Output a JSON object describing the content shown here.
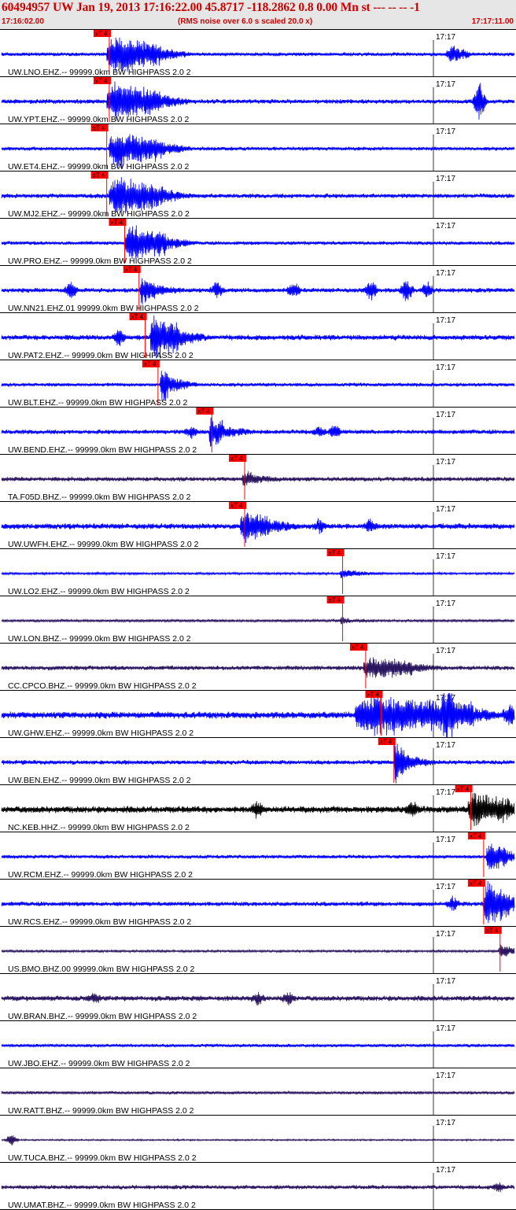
{
  "header": {
    "title": "60494957 UW Jan 19, 2013 17:16:22.00   45.8717 -118.2862  0.8 0.00 Mn st --- -- --  -1",
    "start_time": "17:16:02.00",
    "noise_note": "(RMS noise over 6.0 s scaled 20.0 x)",
    "end_time": "17:17:11.00"
  },
  "colors": {
    "header_bg": "#e6e6e6",
    "header_text": "#cc0000",
    "pick": "#ff0000",
    "trace_blue": "#0000ff",
    "trace_purple": "#2a1660",
    "trace_black": "#000000",
    "label_text": "#000000"
  },
  "minute_label": "17:17",
  "traces": [
    {
      "station": "UW.LNO.EHZ.-- 99999.0km BW  HIGHPASS  2.0  2",
      "pick": "xT 4",
      "pick_t": 0.21,
      "color": "blue",
      "mode": "burst",
      "burst": [
        0.205,
        0.31
      ],
      "base": 0.1,
      "peak": 1.0,
      "extra": [
        {
          "t": 0.88,
          "a": 0.5
        },
        {
          "t": 0.9,
          "a": 0.25
        }
      ]
    },
    {
      "station": "UW.YPT.EHZ.-- 99999.0km BW  HIGHPASS  2.0  2",
      "pick": "xT 4",
      "pick_t": 0.21,
      "color": "blue",
      "mode": "burst",
      "burst": [
        0.205,
        0.31
      ],
      "base": 0.12,
      "peak": 1.0,
      "extra": [
        {
          "t": 0.932,
          "a": 1.1
        }
      ]
    },
    {
      "station": "UW.ET4.EHZ.-- 99999.0km BW  HIGHPASS  2.0  2",
      "pick": "xT 4",
      "pick_t": 0.205,
      "color": "blue",
      "mode": "burst",
      "burst": [
        0.21,
        0.315
      ],
      "base": 0.1,
      "peak": 0.95,
      "extra": []
    },
    {
      "station": "UW.MJ2.EHZ.-- 99999.0km BW  HIGHPASS  2.0  2",
      "pick": "xT 4",
      "pick_t": 0.205,
      "color": "blue",
      "mode": "burst",
      "burst": [
        0.21,
        0.315
      ],
      "base": 0.12,
      "peak": 0.95,
      "extra": []
    },
    {
      "station": "UW.PRO.EHZ.-- 99999.0km BW  HIGHPASS  2.0  2",
      "pick": "xT 4",
      "pick_t": 0.24,
      "color": "blue",
      "mode": "burst",
      "burst": [
        0.24,
        0.32
      ],
      "base": 0.1,
      "peak": 1.0,
      "extra": []
    },
    {
      "station": "UW.NN21.EHZ.01 99999.0km BW  HIGHPASS  2.0  2",
      "pick": "xT 4",
      "pick_t": 0.268,
      "color": "blue",
      "mode": "burst",
      "burst": [
        0.27,
        0.3
      ],
      "base": 0.12,
      "peak": 0.7,
      "extra": [
        {
          "t": 0.135,
          "a": 0.45
        },
        {
          "t": 0.42,
          "a": 0.4
        },
        {
          "t": 0.57,
          "a": 0.4
        },
        {
          "t": 0.72,
          "a": 0.55
        },
        {
          "t": 0.79,
          "a": 0.6
        },
        {
          "t": 0.83,
          "a": 0.4
        }
      ]
    },
    {
      "station": "UW.PAT2.EHZ.-- 99999.0km BW  HIGHPASS  2.0  2",
      "pick": "xT 4",
      "pick_t": 0.28,
      "color": "blue",
      "mode": "clip",
      "burst": [
        0.29,
        0.345
      ],
      "base": 0.14,
      "peak": 1.2,
      "extra": [
        {
          "t": 0.23,
          "a": 0.45
        }
      ]
    },
    {
      "station": "UW.BLT.EHZ.-- 99999.0km BW  HIGHPASS  2.0  2",
      "pick": "xT 4",
      "pick_t": 0.305,
      "color": "blue",
      "mode": "clip",
      "burst": [
        0.31,
        0.325
      ],
      "base": 0.1,
      "peak": 1.2,
      "extra": []
    },
    {
      "station": "UW.BEND.EHZ.-- 99999.0km BW  HIGHPASS  2.0  2",
      "pick": "xT 4",
      "pick_t": 0.41,
      "color": "blue",
      "mode": "burst",
      "burst": [
        0.405,
        0.43
      ],
      "base": 0.12,
      "peak": 0.9,
      "extra": [
        {
          "t": 0.37,
          "a": 0.3
        },
        {
          "t": 0.62,
          "a": 0.3
        },
        {
          "t": 0.65,
          "a": 0.35
        }
      ]
    },
    {
      "station": "TA.F05D.BHZ.-- 99999.0km BW  HIGHPASS  2.0  2",
      "pick": "xT 4",
      "pick_t": 0.474,
      "color": "purple",
      "mode": "burst",
      "burst": [
        0.47,
        0.49
      ],
      "base": 0.12,
      "peak": 0.45,
      "extra": []
    },
    {
      "station": "UW.UWFH.EHZ.-- 99999.0km BW  HIGHPASS  2.0  2",
      "pick": "xT 4",
      "pick_t": 0.474,
      "color": "blue",
      "mode": "burst",
      "burst": [
        0.465,
        0.52
      ],
      "base": 0.15,
      "peak": 0.8,
      "extra": [
        {
          "t": 0.62,
          "a": 0.35
        },
        {
          "t": 0.72,
          "a": 0.3
        }
      ]
    },
    {
      "station": "UW.LO2.EHZ.-- 99999.0km BW  HIGHPASS  2.0  2",
      "pick": "xT 4",
      "pick_t": 0.665,
      "color": "blue",
      "mode": "burst",
      "burst": [
        0.66,
        0.69
      ],
      "base": 0.06,
      "peak": 0.25,
      "extra": []
    },
    {
      "station": "UW.LON.BHZ.-- 99999.0km BW  HIGHPASS  2.0  2",
      "pick": "xT 4",
      "pick_t": 0.665,
      "color": "purple",
      "mode": "burst",
      "burst": [
        0.66,
        0.68
      ],
      "base": 0.07,
      "peak": 0.15,
      "extra": []
    },
    {
      "station": "CC.CPCO.BHZ.-- 99999.0km BW  HIGHPASS  2.0  2",
      "pick": "xT 4",
      "pick_t": 0.71,
      "color": "purple",
      "mode": "burst",
      "burst": [
        0.705,
        0.8
      ],
      "base": 0.12,
      "peak": 0.55,
      "extra": []
    },
    {
      "station": "UW.GHW.EHZ.-- 99999.0km BW  HIGHPASS  2.0  2",
      "pick": "xT 4",
      "pick_t": 0.74,
      "color": "blue",
      "mode": "burst",
      "burst": [
        0.69,
        0.92
      ],
      "base": 0.18,
      "peak": 1.0,
      "extra": [
        {
          "t": 0.87,
          "a": 1.0
        },
        {
          "t": 0.99,
          "a": 0.6
        }
      ]
    },
    {
      "station": "UW.BEN.EHZ.-- 99999.0km BW  HIGHPASS  2.0  2",
      "pick": "xT 4",
      "pick_t": 0.765,
      "color": "blue",
      "mode": "clip",
      "burst": [
        0.765,
        0.785
      ],
      "base": 0.12,
      "peak": 1.2,
      "extra": []
    },
    {
      "station": "NC.KEB.HHZ.-- 99999.0km BW  HIGHPASS  2.0  2",
      "pick": "xT 4",
      "pick_t": 0.915,
      "color": "black",
      "mode": "burst",
      "burst": [
        0.91,
        0.99
      ],
      "base": 0.18,
      "peak": 0.8,
      "extra": [
        {
          "t": 0.5,
          "a": 0.4
        },
        {
          "t": 0.8,
          "a": 0.35
        }
      ]
    },
    {
      "station": "UW.RCM.EHZ.-- 99999.0km BW  HIGHPASS  2.0  2",
      "pick": "xT 4",
      "pick_t": 0.94,
      "color": "blue",
      "mode": "burst",
      "burst": [
        0.945,
        0.985
      ],
      "base": 0.1,
      "peak": 0.9,
      "extra": []
    },
    {
      "station": "UW.RCS.EHZ.-- 99999.0km BW  HIGHPASS  2.0  2",
      "pick": "xT 4",
      "pick_t": 0.94,
      "color": "blue",
      "mode": "clip",
      "burst": [
        0.94,
        0.99
      ],
      "base": 0.12,
      "peak": 1.2,
      "extra": [
        {
          "t": 0.88,
          "a": 0.35
        }
      ]
    },
    {
      "station": "US.BMO.BHZ.00 99999.0km BW  HIGHPASS  2.0  2",
      "pick": "xT 4",
      "pick_t": 0.972,
      "color": "purple",
      "mode": "burst",
      "burst": [
        0.97,
        0.99
      ],
      "base": 0.06,
      "peak": 0.45,
      "extra": []
    },
    {
      "station": "UW.BRAN.BHZ.-- 99999.0km BW  HIGHPASS  2.0  2",
      "pick": "",
      "pick_t": null,
      "color": "purple",
      "mode": "noise",
      "burst": null,
      "base": 0.14,
      "peak": 0,
      "extra": [
        {
          "t": 0.18,
          "a": 0.25
        },
        {
          "t": 0.5,
          "a": 0.3
        },
        {
          "t": 0.56,
          "a": 0.3
        }
      ]
    },
    {
      "station": "UW.JBO.EHZ.-- 99999.0km BW  HIGHPASS  2.0  2",
      "pick": "",
      "pick_t": null,
      "color": "blue",
      "mode": "noise",
      "burst": null,
      "base": 0.09,
      "peak": 0,
      "extra": []
    },
    {
      "station": "UW.RATT.BHZ.-- 99999.0km BW  HIGHPASS  2.0  2",
      "pick": "",
      "pick_t": null,
      "color": "purple",
      "mode": "noise",
      "burst": null,
      "base": 0.08,
      "peak": 0,
      "extra": []
    },
    {
      "station": "UW.TUCA.BHZ.-- 99999.0km BW  HIGHPASS  2.0  2",
      "pick": "",
      "pick_t": null,
      "color": "purple",
      "mode": "noise",
      "burst": null,
      "base": 0.04,
      "peak": 0,
      "extra": [
        {
          "t": 0.02,
          "a": 0.3
        }
      ]
    },
    {
      "station": "UW.UMAT.BHZ.-- 99999.0km BW  HIGHPASS  2.0  2",
      "pick": "",
      "pick_t": null,
      "color": "purple",
      "mode": "noise",
      "burst": null,
      "base": 0.11,
      "peak": 0,
      "extra": [
        {
          "t": 0.97,
          "a": 0.25
        }
      ]
    }
  ]
}
